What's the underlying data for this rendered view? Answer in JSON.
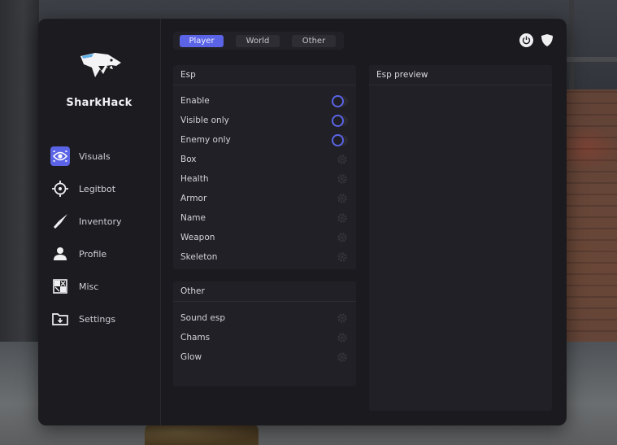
{
  "app": {
    "name": "SharkHack"
  },
  "sidebar": {
    "items": [
      {
        "label": "Visuals",
        "icon": "eye-icon",
        "active": true
      },
      {
        "label": "Legitbot",
        "icon": "crosshair-icon",
        "active": false
      },
      {
        "label": "Inventory",
        "icon": "knife-icon",
        "active": false
      },
      {
        "label": "Profile",
        "icon": "user-icon",
        "active": false
      },
      {
        "label": "Misc",
        "icon": "misc-icon",
        "active": false
      },
      {
        "label": "Settings",
        "icon": "folder-icon",
        "active": false
      }
    ]
  },
  "tabs": [
    {
      "label": "Player",
      "active": true
    },
    {
      "label": "World",
      "active": false
    },
    {
      "label": "Other",
      "active": false
    }
  ],
  "top_icons": [
    "power-icon",
    "shield-icon"
  ],
  "esp_panel": {
    "title": "Esp",
    "toggles": [
      {
        "label": "Enable",
        "control": "toggle"
      },
      {
        "label": "Visible only",
        "control": "toggle"
      },
      {
        "label": "Enemy only",
        "control": "toggle"
      }
    ],
    "options": [
      {
        "label": "Box",
        "control": "settings"
      },
      {
        "label": "Health",
        "control": "settings"
      },
      {
        "label": "Armor",
        "control": "settings"
      },
      {
        "label": "Name",
        "control": "settings"
      },
      {
        "label": "Weapon",
        "control": "settings"
      },
      {
        "label": "Skeleton",
        "control": "settings"
      }
    ]
  },
  "other_panel": {
    "title": "Other",
    "options": [
      {
        "label": "Sound esp",
        "control": "settings"
      },
      {
        "label": "Chams",
        "control": "settings"
      },
      {
        "label": "Glow",
        "control": "settings"
      }
    ]
  },
  "preview_panel": {
    "title": "Esp preview"
  },
  "colors": {
    "accent": "#5b64e6",
    "window_bg": "#1b1a1e",
    "panel_bg": "#202026",
    "text": "#d2d2d8"
  }
}
